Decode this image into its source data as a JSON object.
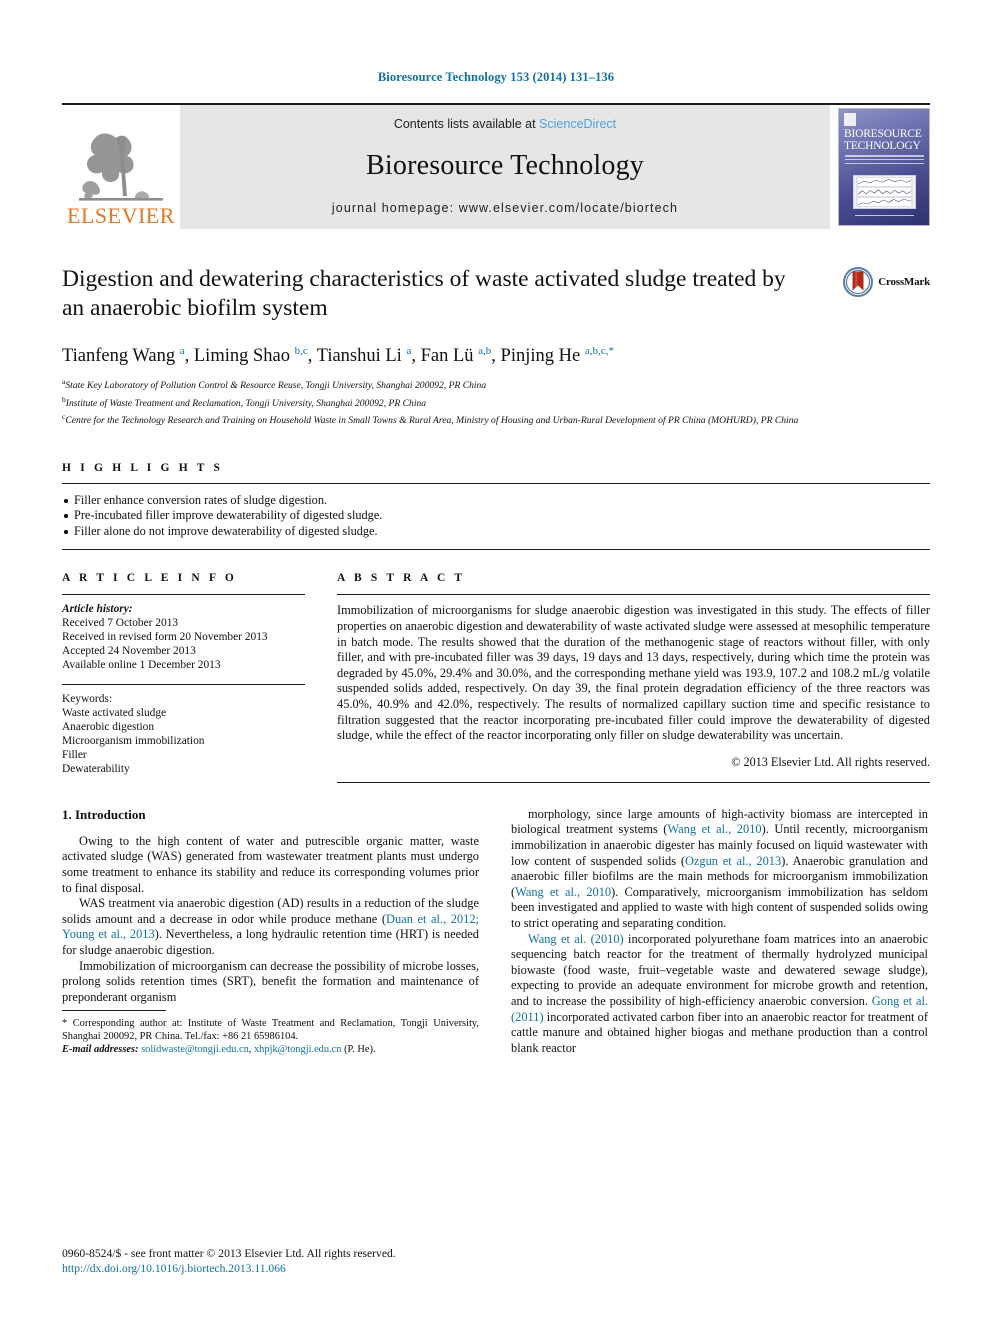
{
  "running_head": "Bioresource Technology 153 (2014) 131–136",
  "masthead": {
    "publisher_name": "ELSEVIER",
    "contents_prefix": "Contents lists available at ",
    "contents_link": "ScienceDirect",
    "journal_title": "Bioresource Technology",
    "homepage": "journal homepage: www.elsevier.com/locate/biortech",
    "cover_title_line1": "BIORESOURCE",
    "cover_title_line2": "TECHNOLOGY"
  },
  "article": {
    "title": "Digestion and dewatering characteristics of waste activated sludge treated by an anaerobic biofilm system",
    "crossmark_label": "CrossMark",
    "authors_html": "Tianfeng Wang <sup>a</sup>, Liming Shao <sup>b,c</sup>, Tianshui Li <sup>a</sup>, Fan Lü <sup>a,b</sup>, Pinjing He <sup>a,b,c,</sup><sup>*</sup>",
    "affiliations": [
      {
        "marker": "a",
        "text": "State Key Laboratory of Pollution Control & Resource Reuse, Tongji University, Shanghai 200092, PR China"
      },
      {
        "marker": "b",
        "text": "Institute of Waste Treatment and Reclamation, Tongji University, Shanghai 200092, PR China"
      },
      {
        "marker": "c",
        "text": "Centre for the Technology Research and Training on Household Waste in Small Towns & Rural Area, Ministry of Housing and Urban-Rural Development of PR China (MOHURD), PR China"
      }
    ]
  },
  "highlights": {
    "heading": "H I G H L I G H T S",
    "items": [
      "Filler enhance conversion rates of sludge digestion.",
      "Pre-incubated filler improve dewaterability of digested sludge.",
      "Filler alone do not improve dewaterability of digested sludge."
    ]
  },
  "article_info": {
    "heading": "A R T I C L E   I N F O",
    "history_label": "Article history:",
    "history": [
      "Received 7 October 2013",
      "Received in revised form 20 November 2013",
      "Accepted 24 November 2013",
      "Available online 1 December 2013"
    ],
    "keywords_label": "Keywords:",
    "keywords": [
      "Waste activated sludge",
      "Anaerobic digestion",
      "Microorganism immobilization",
      "Filler",
      "Dewaterability"
    ]
  },
  "abstract": {
    "heading": "A B S T R A C T",
    "text": "Immobilization of microorganisms for sludge anaerobic digestion was investigated in this study. The effects of filler properties on anaerobic digestion and dewaterability of waste activated sludge were assessed at mesophilic temperature in batch mode. The results showed that the duration of the methanogenic stage of reactors without filler, with only filler, and with pre-incubated filler was 39 days, 19 days and 13 days, respectively, during which time the protein was degraded by 45.0%, 29.4% and 30.0%, and the corresponding methane yield was 193.9, 107.2 and 108.2 mL/g volatile suspended solids added, respectively. On day 39, the final protein degradation efficiency of the three reactors was 45.0%, 40.9% and 42.0%, respectively. The results of normalized capillary suction time and specific resistance to filtration suggested that the reactor incorporating pre-incubated filler could improve the dewaterability of digested sludge, while the effect of the reactor incorporating only filler on sludge dewaterability was uncertain.",
    "copyright": "© 2013 Elsevier Ltd. All rights reserved."
  },
  "body": {
    "section_title": "1. Introduction",
    "left_paragraphs": [
      "Owing to the high content of water and putrescible organic matter, waste activated sludge (WAS) generated from wastewater treatment plants must undergo some treatment to enhance its stability and reduce its corresponding volumes prior to final disposal.",
      "WAS treatment via anaerobic digestion (AD) results in a reduction of the sludge solids amount and a decrease in odor while produce methane (||Duan et al., 2012; Young et al., 2013||). Nevertheless, a long hydraulic retention time (HRT) is needed for sludge anaerobic digestion.",
      "Immobilization of microorganism can decrease the possibility of microbe losses, prolong solids retention times (SRT), benefit the formation and maintenance of preponderant organism"
    ],
    "right_paragraphs": [
      "morphology, since large amounts of high-activity biomass are intercepted in biological treatment systems (||Wang et al., 2010||). Until recently, microorganism immobilization in anaerobic digester has mainly focused on liquid wastewater with low content of suspended solids (||Ozgun et al., 2013||). Anaerobic granulation and anaerobic filler biofilms are the main methods for microorganism immobilization (||Wang et al., 2010||). Comparatively, microorganism immobilization has seldom been investigated and applied to waste with high content of suspended solids owing to strict operating and separating condition.",
      "||Wang et al. (2010)|| incorporated polyurethane foam matrices into an anaerobic sequencing batch reactor for the treatment of thermally hydrolyzed municipal biowaste (food waste, fruit–vegetable waste and dewatered sewage sludge), expecting to provide an adequate environment for microbe growth and retention, and to increase the possibility of high-efficiency anaerobic conversion. ||Gong et al. (2011)|| incorporated activated carbon fiber into an anaerobic reactor for treatment of cattle manure and obtained higher biogas and methane production than a control blank reactor"
    ]
  },
  "footnote": {
    "corresponding": "* Corresponding author at: Institute of Waste Treatment and Reclamation, Tongji University, Shanghai 200092, PR China. Tel./fax: +86 21 65986104.",
    "email_label": "E-mail addresses:",
    "email_1": "solidwaste@tongji.edu.cn",
    "email_2": "xhpjk@tongji.edu.cn",
    "email_suffix": "(P. He)."
  },
  "bottom": {
    "issn_line": "0960-8524/$ - see front matter © 2013 Elsevier Ltd. All rights reserved.",
    "doi_line": "http://dx.doi.org/10.1016/j.biortech.2013.11.066"
  },
  "colors": {
    "link_blue": "#1270a8",
    "science_direct_blue": "#4aa3df",
    "elsevier_orange": "#e87722",
    "band_gray": "#e6e6e6"
  }
}
